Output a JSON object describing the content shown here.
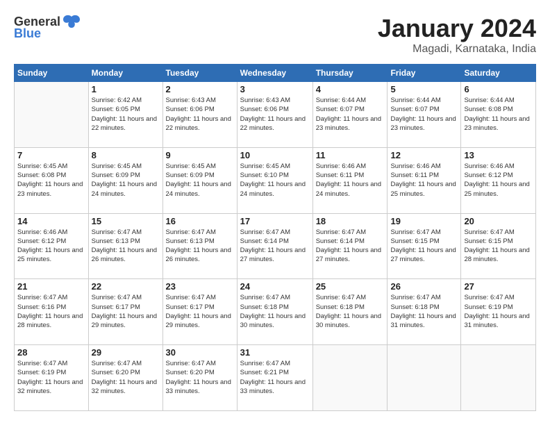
{
  "logo": {
    "general": "General",
    "blue": "Blue"
  },
  "title": "January 2024",
  "location": "Magadi, Karnataka, India",
  "weekdays": [
    "Sunday",
    "Monday",
    "Tuesday",
    "Wednesday",
    "Thursday",
    "Friday",
    "Saturday"
  ],
  "weeks": [
    [
      {
        "day": "",
        "sunrise": "",
        "sunset": "",
        "daylight": ""
      },
      {
        "day": "1",
        "sunrise": "Sunrise: 6:42 AM",
        "sunset": "Sunset: 6:05 PM",
        "daylight": "Daylight: 11 hours and 22 minutes."
      },
      {
        "day": "2",
        "sunrise": "Sunrise: 6:43 AM",
        "sunset": "Sunset: 6:06 PM",
        "daylight": "Daylight: 11 hours and 22 minutes."
      },
      {
        "day": "3",
        "sunrise": "Sunrise: 6:43 AM",
        "sunset": "Sunset: 6:06 PM",
        "daylight": "Daylight: 11 hours and 22 minutes."
      },
      {
        "day": "4",
        "sunrise": "Sunrise: 6:44 AM",
        "sunset": "Sunset: 6:07 PM",
        "daylight": "Daylight: 11 hours and 23 minutes."
      },
      {
        "day": "5",
        "sunrise": "Sunrise: 6:44 AM",
        "sunset": "Sunset: 6:07 PM",
        "daylight": "Daylight: 11 hours and 23 minutes."
      },
      {
        "day": "6",
        "sunrise": "Sunrise: 6:44 AM",
        "sunset": "Sunset: 6:08 PM",
        "daylight": "Daylight: 11 hours and 23 minutes."
      }
    ],
    [
      {
        "day": "7",
        "sunrise": "Sunrise: 6:45 AM",
        "sunset": "Sunset: 6:08 PM",
        "daylight": "Daylight: 11 hours and 23 minutes."
      },
      {
        "day": "8",
        "sunrise": "Sunrise: 6:45 AM",
        "sunset": "Sunset: 6:09 PM",
        "daylight": "Daylight: 11 hours and 24 minutes."
      },
      {
        "day": "9",
        "sunrise": "Sunrise: 6:45 AM",
        "sunset": "Sunset: 6:09 PM",
        "daylight": "Daylight: 11 hours and 24 minutes."
      },
      {
        "day": "10",
        "sunrise": "Sunrise: 6:45 AM",
        "sunset": "Sunset: 6:10 PM",
        "daylight": "Daylight: 11 hours and 24 minutes."
      },
      {
        "day": "11",
        "sunrise": "Sunrise: 6:46 AM",
        "sunset": "Sunset: 6:11 PM",
        "daylight": "Daylight: 11 hours and 24 minutes."
      },
      {
        "day": "12",
        "sunrise": "Sunrise: 6:46 AM",
        "sunset": "Sunset: 6:11 PM",
        "daylight": "Daylight: 11 hours and 25 minutes."
      },
      {
        "day": "13",
        "sunrise": "Sunrise: 6:46 AM",
        "sunset": "Sunset: 6:12 PM",
        "daylight": "Daylight: 11 hours and 25 minutes."
      }
    ],
    [
      {
        "day": "14",
        "sunrise": "Sunrise: 6:46 AM",
        "sunset": "Sunset: 6:12 PM",
        "daylight": "Daylight: 11 hours and 25 minutes."
      },
      {
        "day": "15",
        "sunrise": "Sunrise: 6:47 AM",
        "sunset": "Sunset: 6:13 PM",
        "daylight": "Daylight: 11 hours and 26 minutes."
      },
      {
        "day": "16",
        "sunrise": "Sunrise: 6:47 AM",
        "sunset": "Sunset: 6:13 PM",
        "daylight": "Daylight: 11 hours and 26 minutes."
      },
      {
        "day": "17",
        "sunrise": "Sunrise: 6:47 AM",
        "sunset": "Sunset: 6:14 PM",
        "daylight": "Daylight: 11 hours and 27 minutes."
      },
      {
        "day": "18",
        "sunrise": "Sunrise: 6:47 AM",
        "sunset": "Sunset: 6:14 PM",
        "daylight": "Daylight: 11 hours and 27 minutes."
      },
      {
        "day": "19",
        "sunrise": "Sunrise: 6:47 AM",
        "sunset": "Sunset: 6:15 PM",
        "daylight": "Daylight: 11 hours and 27 minutes."
      },
      {
        "day": "20",
        "sunrise": "Sunrise: 6:47 AM",
        "sunset": "Sunset: 6:15 PM",
        "daylight": "Daylight: 11 hours and 28 minutes."
      }
    ],
    [
      {
        "day": "21",
        "sunrise": "Sunrise: 6:47 AM",
        "sunset": "Sunset: 6:16 PM",
        "daylight": "Daylight: 11 hours and 28 minutes."
      },
      {
        "day": "22",
        "sunrise": "Sunrise: 6:47 AM",
        "sunset": "Sunset: 6:17 PM",
        "daylight": "Daylight: 11 hours and 29 minutes."
      },
      {
        "day": "23",
        "sunrise": "Sunrise: 6:47 AM",
        "sunset": "Sunset: 6:17 PM",
        "daylight": "Daylight: 11 hours and 29 minutes."
      },
      {
        "day": "24",
        "sunrise": "Sunrise: 6:47 AM",
        "sunset": "Sunset: 6:18 PM",
        "daylight": "Daylight: 11 hours and 30 minutes."
      },
      {
        "day": "25",
        "sunrise": "Sunrise: 6:47 AM",
        "sunset": "Sunset: 6:18 PM",
        "daylight": "Daylight: 11 hours and 30 minutes."
      },
      {
        "day": "26",
        "sunrise": "Sunrise: 6:47 AM",
        "sunset": "Sunset: 6:18 PM",
        "daylight": "Daylight: 11 hours and 31 minutes."
      },
      {
        "day": "27",
        "sunrise": "Sunrise: 6:47 AM",
        "sunset": "Sunset: 6:19 PM",
        "daylight": "Daylight: 11 hours and 31 minutes."
      }
    ],
    [
      {
        "day": "28",
        "sunrise": "Sunrise: 6:47 AM",
        "sunset": "Sunset: 6:19 PM",
        "daylight": "Daylight: 11 hours and 32 minutes."
      },
      {
        "day": "29",
        "sunrise": "Sunrise: 6:47 AM",
        "sunset": "Sunset: 6:20 PM",
        "daylight": "Daylight: 11 hours and 32 minutes."
      },
      {
        "day": "30",
        "sunrise": "Sunrise: 6:47 AM",
        "sunset": "Sunset: 6:20 PM",
        "daylight": "Daylight: 11 hours and 33 minutes."
      },
      {
        "day": "31",
        "sunrise": "Sunrise: 6:47 AM",
        "sunset": "Sunset: 6:21 PM",
        "daylight": "Daylight: 11 hours and 33 minutes."
      },
      {
        "day": "",
        "sunrise": "",
        "sunset": "",
        "daylight": ""
      },
      {
        "day": "",
        "sunrise": "",
        "sunset": "",
        "daylight": ""
      },
      {
        "day": "",
        "sunrise": "",
        "sunset": "",
        "daylight": ""
      }
    ]
  ]
}
